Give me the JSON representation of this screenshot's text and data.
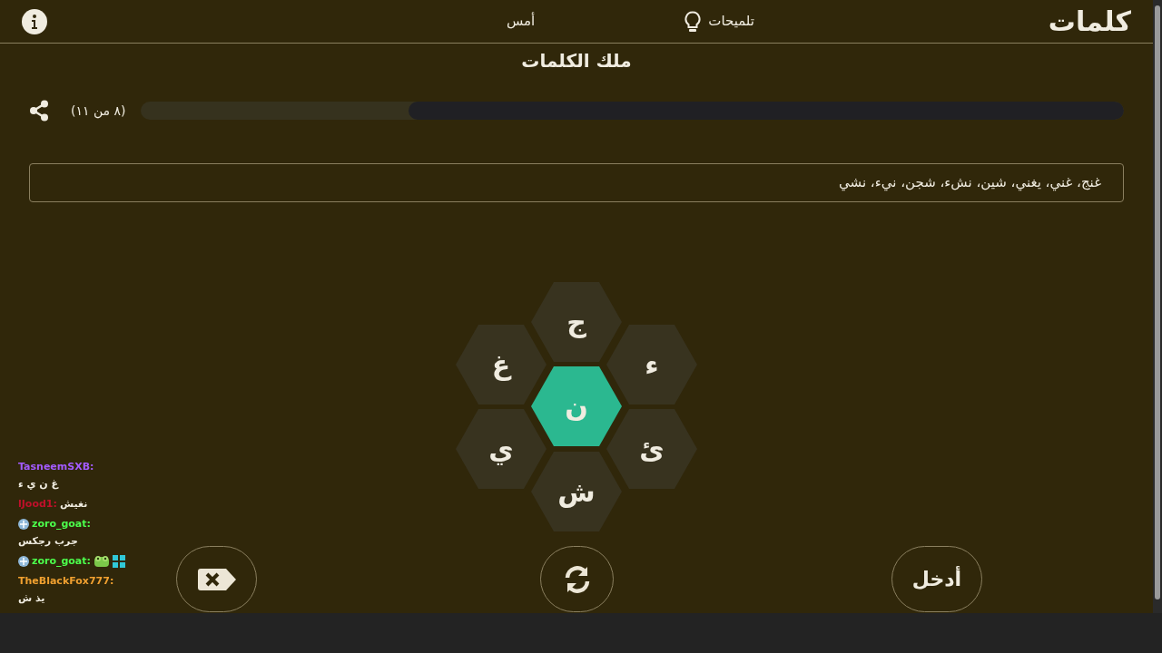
{
  "header": {
    "logo": "كلمات",
    "hints": "تلميحات",
    "yesterday": "أمس"
  },
  "title": "ملك الكلمات",
  "progress": {
    "count": "(٨ من ١١)",
    "level": 0.727
  },
  "found_words": "غنج، غني، يغني، شين، نشء، شجن، نيء، نشي",
  "letters": [
    {
      "letter": "ج",
      "selected": false
    },
    {
      "letter": "ء",
      "selected": false
    },
    {
      "letter": "غ",
      "selected": false
    },
    {
      "letter": "ن",
      "selected": true
    },
    {
      "letter": "ئ",
      "selected": false
    },
    {
      "letter": "ي",
      "selected": false
    },
    {
      "letter": "ش",
      "selected": false
    }
  ],
  "buttons": {
    "enter": "أدخل"
  },
  "chat": [
    {
      "kind": "text",
      "user": "TasneemSXB:",
      "color": "#a35bff",
      "message": "غ ن ي ء",
      "badge": false
    },
    {
      "kind": "text",
      "user": "lJood1:",
      "color": "#c0102a",
      "message": "نغيش",
      "badge": false
    },
    {
      "kind": "text",
      "user": "zoro_goat:",
      "color": "#4cff4c",
      "message": "جرب رجكس",
      "badge": true
    },
    {
      "kind": "emote",
      "user": "zoro_goat:",
      "color": "#4cff4c",
      "badge": true
    },
    {
      "kind": "text",
      "user": "TheBlackFox777:",
      "color": "#f0a030",
      "message": "يذ ش",
      "badge": false
    }
  ]
}
